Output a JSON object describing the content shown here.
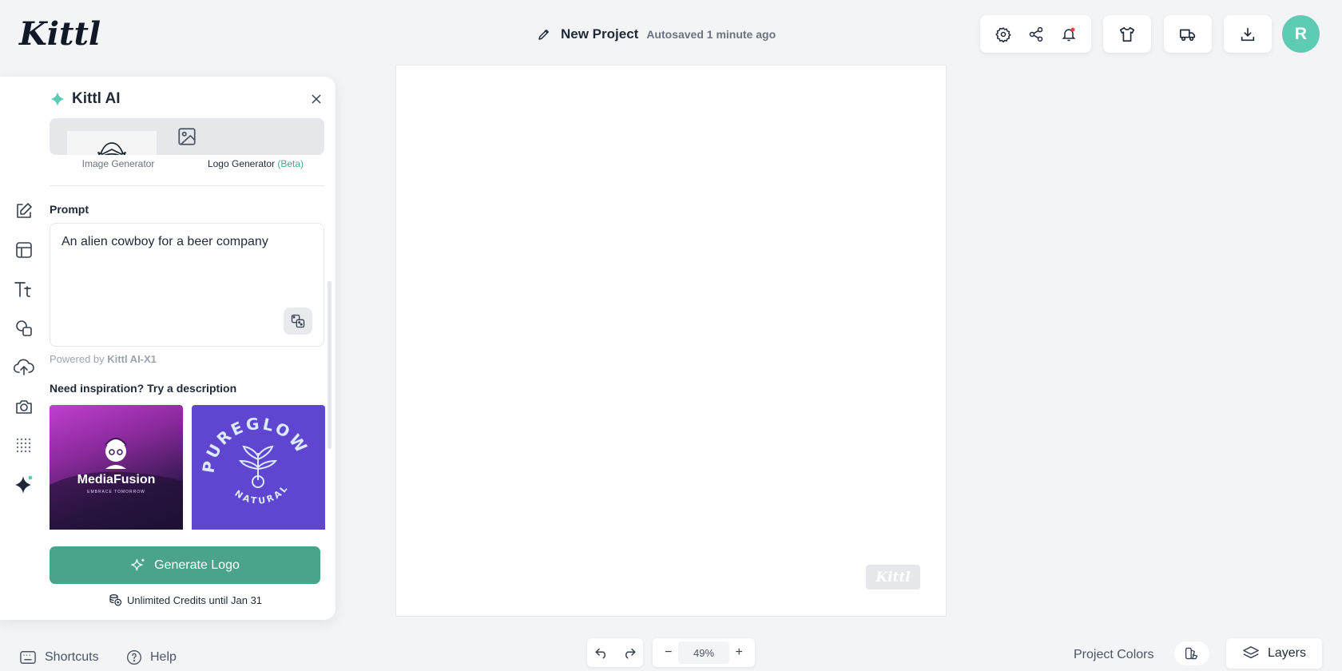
{
  "brand": {
    "logo_text": "Kittl",
    "watermark": "Kittl"
  },
  "header": {
    "project_title": "New Project",
    "autosave_status": "Autosaved 1 minute ago",
    "avatar_initial": "R",
    "accent_color": "#5ecbb3",
    "icons": [
      "settings-icon",
      "share-icon",
      "notification-bell-icon",
      "tshirt-icon",
      "delivery-truck-icon",
      "download-icon"
    ]
  },
  "rail": {
    "items": [
      "edit-icon",
      "templates-icon",
      "text-icon",
      "elements-icon",
      "upload-icon",
      "photos-icon",
      "pattern-icon",
      "ai-sparkle-icon"
    ]
  },
  "ai_panel": {
    "title": "Kittl AI",
    "tabs": {
      "image_label": "Image Generator",
      "logo_label": "Logo Generator",
      "beta_tag": "(Beta)"
    },
    "prompt": {
      "label": "Prompt",
      "value": "An alien cowboy for a beer company"
    },
    "powered_prefix": "Powered by",
    "powered_model": "Kittl AI-X1",
    "inspiration_label": "Need inspiration? Try a description",
    "examples": [
      {
        "brand": "MediaFusion",
        "tagline": "EMBRACE TOMORROW"
      },
      {
        "brand": "PUREGLOW",
        "tagline": "NATURAL"
      }
    ],
    "generate_label": "Generate Logo",
    "credits_text": "Unlimited Credits until Jan 31",
    "button_color": "#4ba38c"
  },
  "bottom": {
    "shortcuts_label": "Shortcuts",
    "help_label": "Help",
    "zoom": "49%",
    "zoom_out": "−",
    "zoom_in": "+",
    "project_colors_label": "Project Colors",
    "layers_label": "Layers"
  }
}
